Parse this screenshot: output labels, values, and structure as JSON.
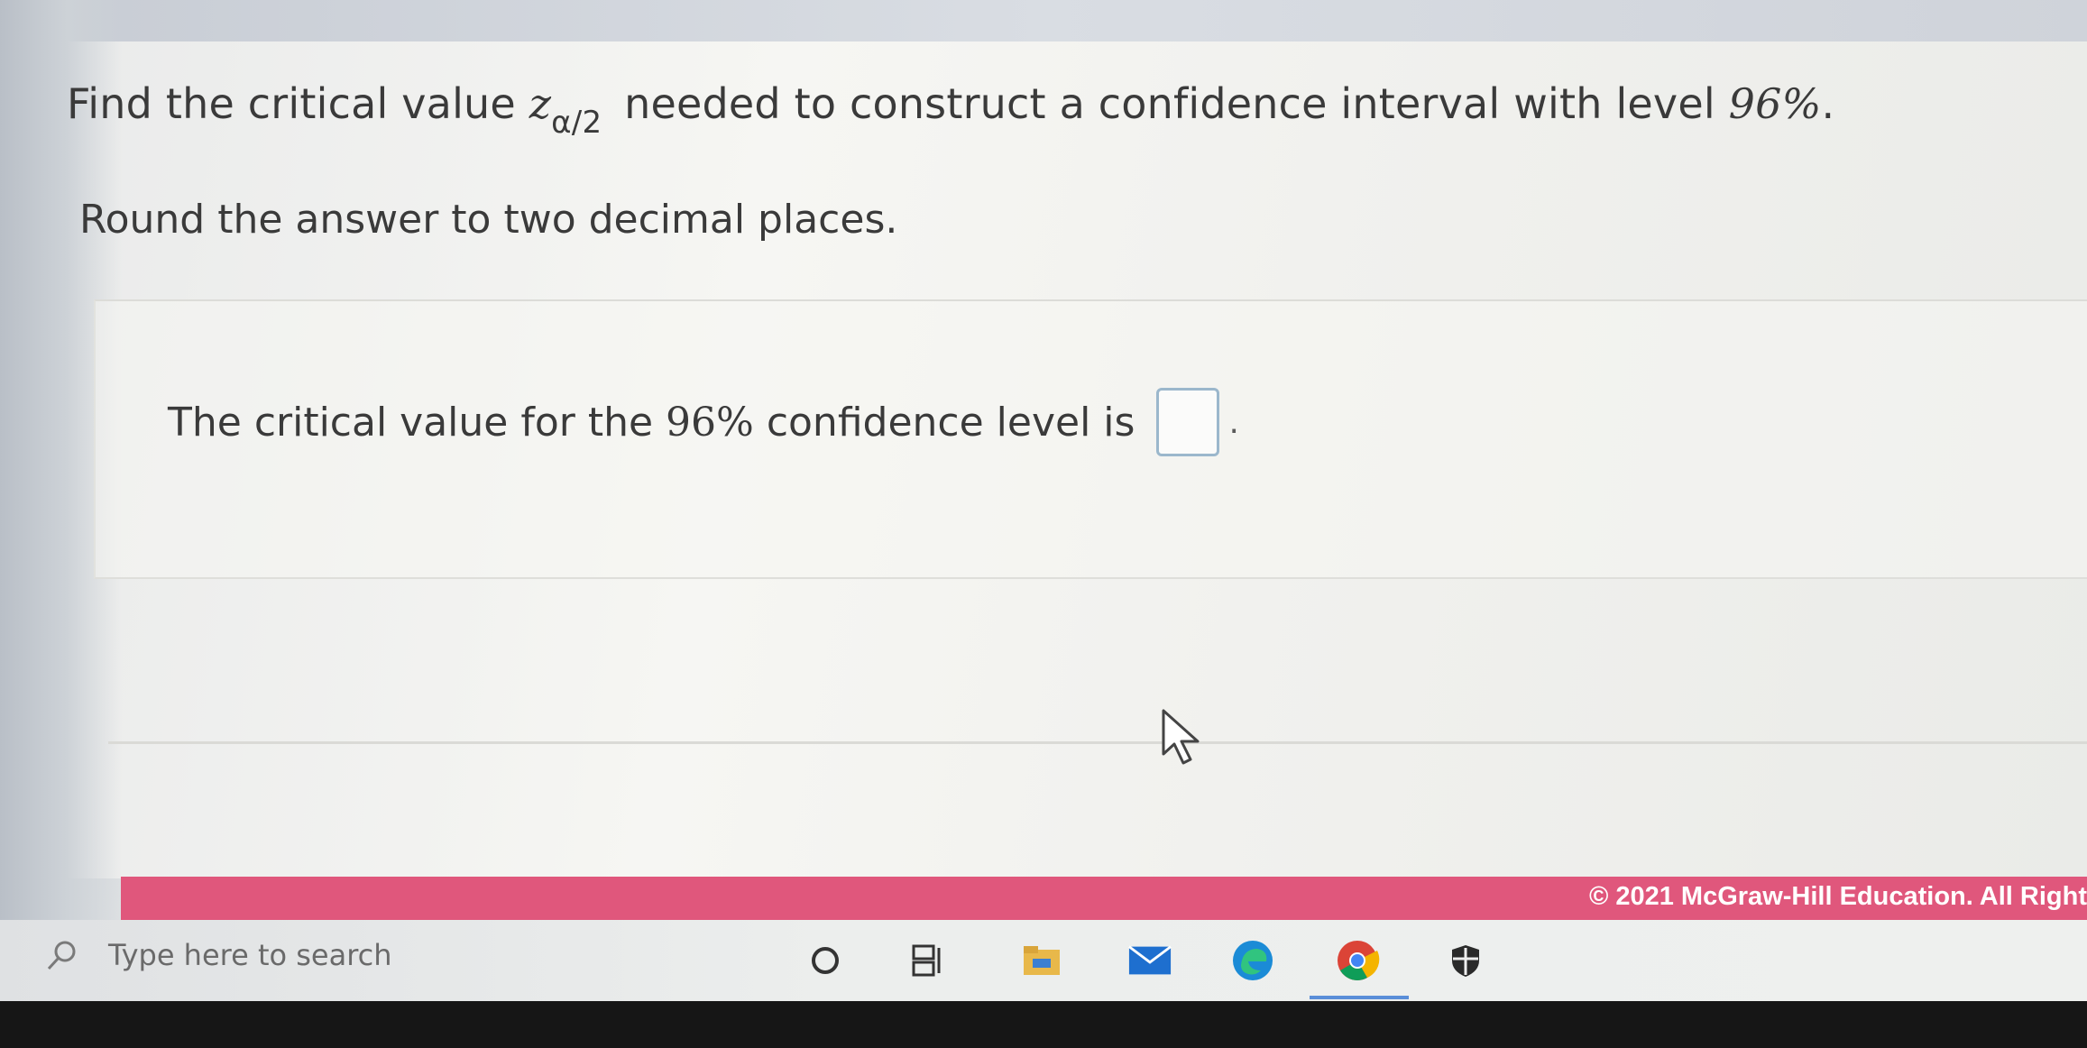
{
  "question": {
    "prefix": "Find the critical value ",
    "variable": "z",
    "subscript": "α/2",
    "middle": " needed to construct a confidence interval with level ",
    "level": "96%",
    "suffix": "."
  },
  "instruction": "Round the answer to two decimal places.",
  "answer": {
    "prefix": "The critical value for the ",
    "level": "96%",
    "suffix": " confidence level is",
    "input_value": "",
    "end": "."
  },
  "footer": {
    "copyright": "© 2021 McGraw-Hill Education. All Right"
  },
  "taskbar": {
    "search_placeholder": "Type here to search",
    "icons": [
      "search-icon",
      "cortana-icon",
      "task-view-icon",
      "file-explorer-icon",
      "mail-icon",
      "edge-icon",
      "chrome-icon",
      "security-icon"
    ]
  },
  "colors": {
    "footer_bar": "#e0577c",
    "input_border": "#9bb7cc",
    "taskbar_active": "#5a8ed8"
  }
}
